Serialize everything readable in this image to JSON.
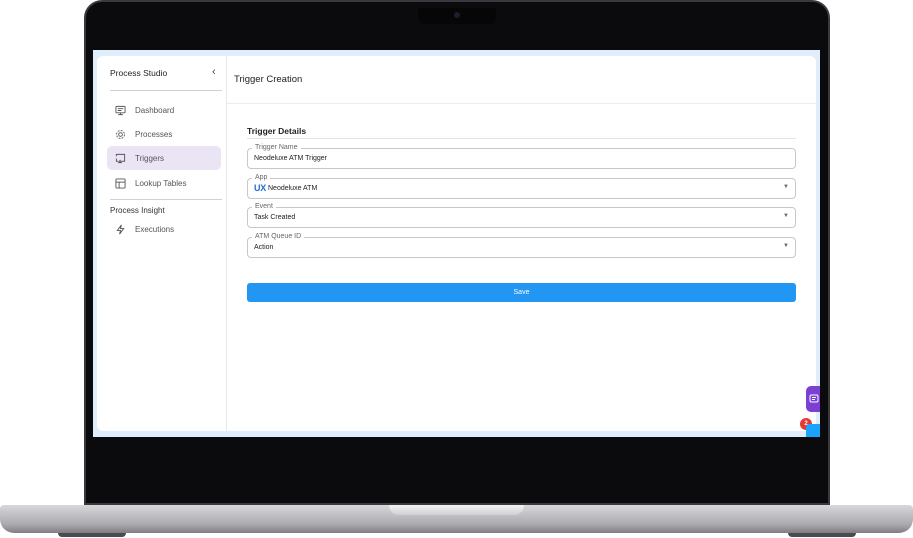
{
  "sidebar": {
    "title": "Process Studio",
    "collapse_icon": "chevron-left-icon",
    "items": [
      {
        "label": "Dashboard",
        "icon": "monitor-icon"
      },
      {
        "label": "Processes",
        "icon": "gear-icon"
      },
      {
        "label": "Triggers",
        "icon": "trigger-icon",
        "active": true
      },
      {
        "label": "Lookup Tables",
        "icon": "table-icon"
      }
    ],
    "section_title": "Process Insight",
    "section_items": [
      {
        "label": "Executions",
        "icon": "bolt-icon"
      }
    ]
  },
  "main": {
    "title": "Trigger Creation",
    "section_title": "Trigger Details",
    "fields": {
      "trigger_name": {
        "label": "Trigger Name",
        "value": "Neodeluxe ATM Trigger"
      },
      "app": {
        "label": "App",
        "value": "Neodeluxe ATM",
        "logo": "UX"
      },
      "event": {
        "label": "Event",
        "value": "Task Created"
      },
      "atm_queue_id": {
        "label": "ATM Queue ID",
        "value": "Action"
      }
    },
    "save_label": "Save"
  },
  "widgets": {
    "notification_count": "2",
    "chat_icon": "chat-icon"
  },
  "colors": {
    "accent": "#2196f3",
    "active_nav_bg": "#ebe4f5",
    "chat_fab": "#7b3fd4",
    "badge": "#e53935"
  }
}
